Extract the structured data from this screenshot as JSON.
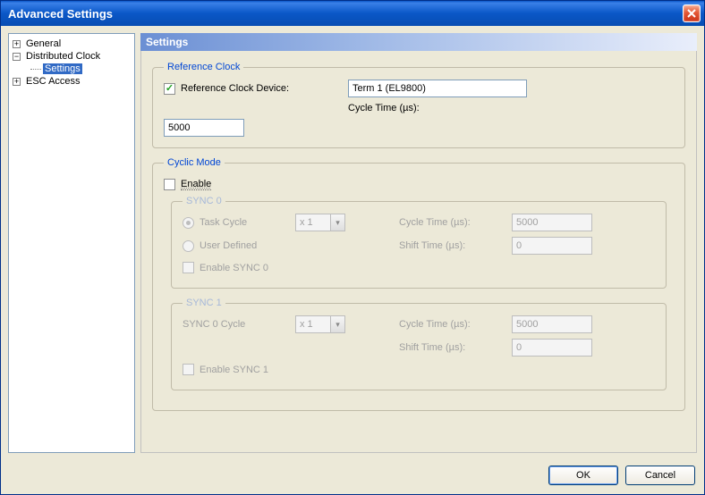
{
  "window": {
    "title": "Advanced Settings"
  },
  "tree": {
    "items": [
      {
        "label": "General",
        "symbol": "+"
      },
      {
        "label": "Distributed Clock",
        "symbol": "−"
      },
      {
        "label": "Settings"
      },
      {
        "label": "ESC Access",
        "symbol": "+"
      }
    ]
  },
  "panel": {
    "header": "Settings"
  },
  "ref_clock": {
    "legend": "Reference Clock",
    "device_label": "Reference Clock Device:",
    "device_value": "Term 1 (EL9800)",
    "cycle_label": "Cycle Time (µs):",
    "cycle_value": "5000"
  },
  "cyclic": {
    "legend": "Cyclic Mode",
    "enable_label": "Enable"
  },
  "sync0": {
    "legend": "SYNC 0",
    "task_cycle_label": "Task Cycle",
    "user_defined_label": "User Defined",
    "multiplier": "x 1",
    "cycle_label": "Cycle Time (µs):",
    "cycle_value": "5000",
    "shift_label": "Shift Time (µs):",
    "shift_value": "0",
    "enable_label": "Enable SYNC 0"
  },
  "sync1": {
    "legend": "SYNC 1",
    "sync0_cycle_label": "SYNC 0 Cycle",
    "multiplier": "x 1",
    "cycle_label": "Cycle Time (µs):",
    "cycle_value": "5000",
    "shift_label": "Shift Time (µs):",
    "shift_value": "0",
    "enable_label": "Enable SYNC 1"
  },
  "buttons": {
    "ok": "OK",
    "cancel": "Cancel"
  }
}
